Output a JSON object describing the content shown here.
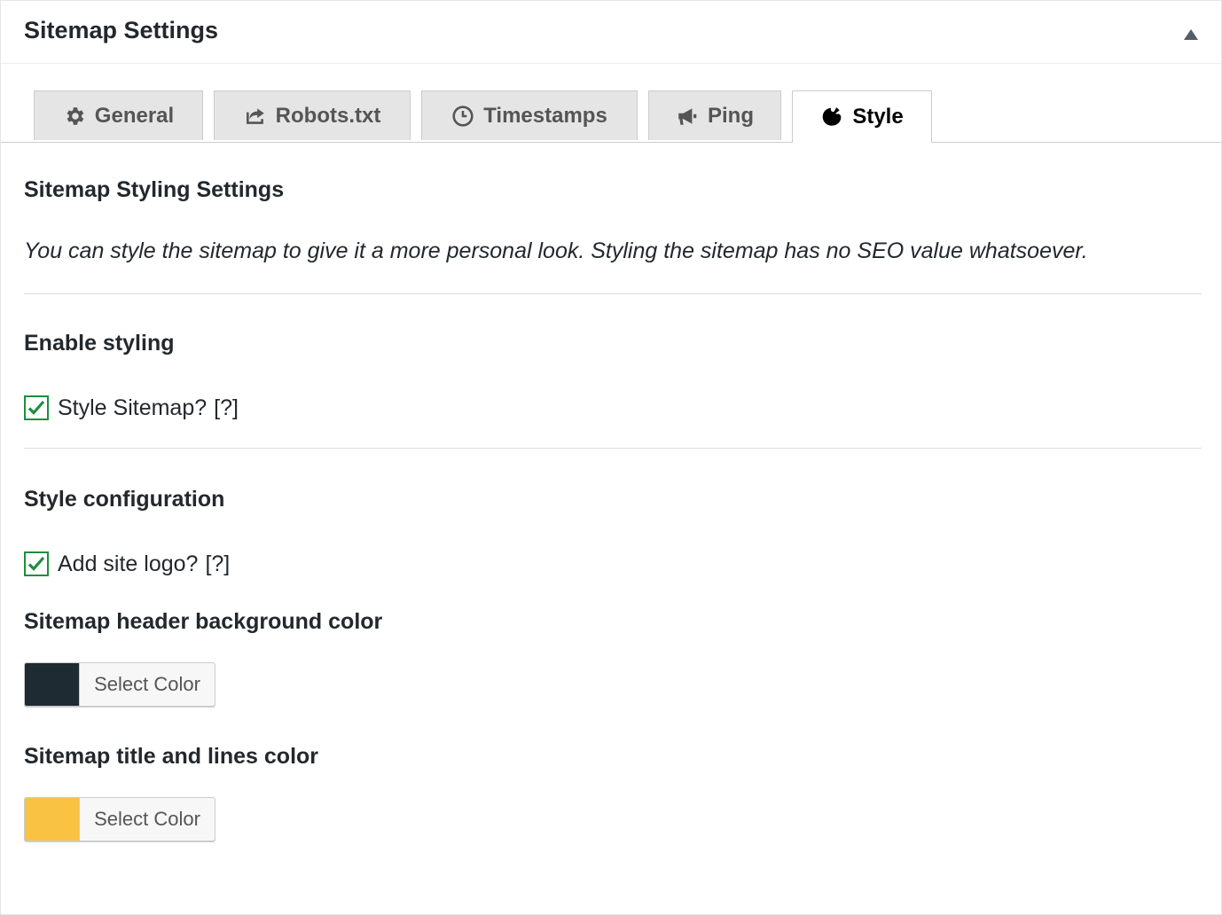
{
  "panel": {
    "title": "Sitemap Settings"
  },
  "tabs": [
    {
      "label": "General",
      "icon": "gear-icon",
      "active": false
    },
    {
      "label": "Robots.txt",
      "icon": "share-icon",
      "active": false
    },
    {
      "label": "Timestamps",
      "icon": "clock-icon",
      "active": false
    },
    {
      "label": "Ping",
      "icon": "megaphone-icon",
      "active": false
    },
    {
      "label": "Style",
      "icon": "palette-icon",
      "active": true
    }
  ],
  "content": {
    "heading": "Sitemap Styling Settings",
    "description": "You can style the sitemap to give it a more personal look. Styling the sitemap has no SEO value whatsoever.",
    "enable_section": {
      "heading": "Enable styling",
      "style_sitemap": {
        "label": "Style Sitemap?",
        "help": "[?]",
        "checked": true
      }
    },
    "config_section": {
      "heading": "Style configuration",
      "add_logo": {
        "label": "Add site logo?",
        "help": "[?]",
        "checked": true
      },
      "header_bg": {
        "heading": "Sitemap header background color",
        "button_label": "Select Color",
        "color": "#1e2b33"
      },
      "title_lines": {
        "heading": "Sitemap title and lines color",
        "button_label": "Select Color",
        "color": "#f9c242"
      }
    }
  },
  "colors": {
    "checkbox_border": "#1e8e3e",
    "check_mark": "#1e8e3e",
    "tab_inactive_bg": "#e5e5e5",
    "text": "#23282d"
  }
}
